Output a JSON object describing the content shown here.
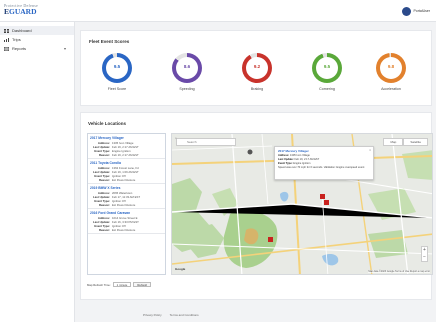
{
  "header": {
    "logo_line1": "Protective Defense",
    "logo_line2a": "E",
    "logo_line2b": "GUARD",
    "user_name": "PortalUser"
  },
  "sidebar": {
    "items": [
      {
        "label": "Dashboard"
      },
      {
        "label": "Trips"
      },
      {
        "label": "Reports",
        "caret": "▾"
      }
    ]
  },
  "scores": {
    "title": "Fleet Event Scores",
    "gauges": [
      {
        "label": "Fleet Score",
        "value": "9.5",
        "color": "#2a66c4",
        "fraction": 0.95
      },
      {
        "label": "Speeding",
        "value": "8.6",
        "color": "#6a4aa8",
        "fraction": 0.86
      },
      {
        "label": "Braking",
        "value": "9.2",
        "color": "#c8332c",
        "fraction": 0.92
      },
      {
        "label": "Cornering",
        "value": "9.5",
        "color": "#5aa83a",
        "fraction": 0.95
      },
      {
        "label": "Acceleration",
        "value": "9.8",
        "color": "#e2812d",
        "fraction": 0.98
      }
    ]
  },
  "locations": {
    "title": "Vehicle Locations",
    "keys": {
      "address": "Address:",
      "last_update": "Last Update:",
      "event": "Event Type:",
      "reason": "Reason:"
    },
    "vehicles": [
      {
        "name": "2017 Mercury Villager",
        "address": "1305 Ivon Village",
        "last_update": "Feb 19, 2:17 AM EST",
        "event": "Engine Ignition",
        "reason": "Feb 19, 2:17 AM EST"
      },
      {
        "name": "2011 Toyota Corolla",
        "address": "1362 Forest Lane, Fd",
        "last_update": "Feb 19, 1:09 AM EST",
        "event": "Ignition Off",
        "reason": "Ext Power Restore"
      },
      {
        "name": "2019 BMW X Series",
        "address": "2065 Watertown",
        "last_update": "Feb 17, 11:33 AM EST",
        "event": "Ignition Off",
        "reason": "Ext Power Restore"
      },
      {
        "name": "2016 Ford Grand Caravan",
        "address": "1014 Grove Street E",
        "last_update": "Feb 16, 3:33 PM EST",
        "event": "Ignition Off",
        "reason": "Ext Power Restore"
      }
    ]
  },
  "map": {
    "search_placeholder": "Search",
    "btn_map": "Map",
    "btn_satellite": "Satellite",
    "popup": {
      "title": "2017 Mercury Villager",
      "address_k": "Address:",
      "address_v": "1305 Ivon Village",
      "update_k": "Last Update:",
      "update_v": "Feb 19, 2:17 AM EST",
      "event_k": "Event Type:",
      "event_v": "Engine Ignition",
      "note": "Speed was over 70 mph for 6 seconds. Validation: Engine overspeed event"
    },
    "zoom_in": "+",
    "zoom_out": "−",
    "google": "Google",
    "attribution": "Map data ©2023 Google  Terms of Use  Report a map error"
  },
  "refresh": {
    "label": "Map Refresh Time:",
    "value": "1 minute",
    "button": "Refresh"
  },
  "footer": {
    "privacy": "Privacy Policy",
    "terms": "Terms and Conditions"
  }
}
